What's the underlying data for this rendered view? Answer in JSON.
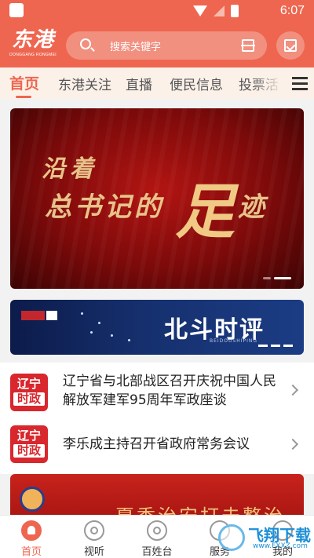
{
  "status_bar": {
    "time": "6:07"
  },
  "header": {
    "logo_text": "东港",
    "logo_sub": "DONGGANG RONGMEI",
    "search_placeholder": "搜索关键字"
  },
  "tabs": [
    {
      "label": "首页",
      "active": true
    },
    {
      "label": "东港关注"
    },
    {
      "label": "直播"
    },
    {
      "label": "便民信息"
    },
    {
      "label": "投票活"
    }
  ],
  "banner": {
    "line1": "沿着",
    "line2": "总书记的",
    "big_char": "足",
    "line2_tail": "迹"
  },
  "strip": {
    "title": "北斗时评",
    "subtitle": "BEIDOUSHIPING"
  },
  "news": [
    {
      "thumb_top": "辽宁",
      "thumb_bottom": "时政",
      "headline": "辽宁省与北部战区召开庆祝中国人民解放军建军95周年军政座谈"
    },
    {
      "thumb_top": "辽宁",
      "thumb_bottom": "时政",
      "headline": "李乐成主持召开省政府常务会议"
    }
  ],
  "promo": {
    "text": "夏季治安打击整治"
  },
  "bottom_nav": [
    {
      "label": "首页",
      "icon": "home-icon",
      "active": true
    },
    {
      "label": "视听",
      "icon": "film-reel-icon"
    },
    {
      "label": "百姓台",
      "icon": "community-icon"
    },
    {
      "label": "服务",
      "icon": "service-icon"
    },
    {
      "label": "我的",
      "icon": "profile-icon"
    }
  ],
  "watermark": {
    "title": "飞翔下载",
    "url": "www.FXXZ.com"
  },
  "colors": {
    "brand": "#ee6650",
    "news_red": "#d8272d"
  }
}
